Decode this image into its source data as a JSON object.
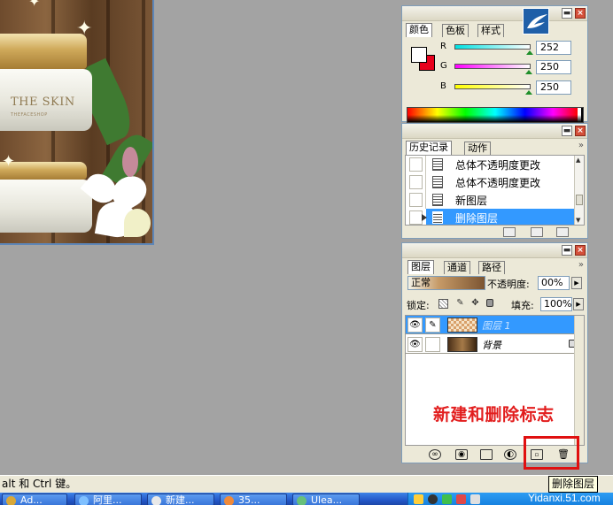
{
  "color_panel": {
    "tabs": [
      "颜色",
      "色板",
      "样式"
    ],
    "channels": [
      {
        "label": "R",
        "value": "252",
        "gradient": [
          "#00e1e1",
          "#ffffff"
        ],
        "fraction": 0.99
      },
      {
        "label": "G",
        "value": "250",
        "gradient": [
          "#ff00ff",
          "#ffffff"
        ],
        "fraction": 0.98
      },
      {
        "label": "B",
        "value": "250",
        "gradient": [
          "#ffff00",
          "#ffffff"
        ],
        "fraction": 0.98
      }
    ],
    "foreground_color": "#ffffff",
    "background_color": "#e8001c"
  },
  "history_panel": {
    "tabs": [
      "历史记录",
      "动作"
    ],
    "items": [
      {
        "label": "总体不透明度更改",
        "active": false
      },
      {
        "label": "总体不透明度更改",
        "active": false
      },
      {
        "label": "新图层",
        "active": false
      },
      {
        "label": "删除图层",
        "active": true
      }
    ]
  },
  "layers_panel": {
    "tabs": [
      "图层",
      "通道",
      "路径"
    ],
    "blend_mode": "正常",
    "opacity_label": "不透明度:",
    "opacity_value": "00%",
    "lock_label": "锁定:",
    "fill_label": "填充:",
    "fill_value": "100%",
    "layers": [
      {
        "name": "图层 1",
        "active": true,
        "locked": false
      },
      {
        "name": "背景",
        "active": false,
        "locked": true
      }
    ]
  },
  "annotation": "新建和删除标志",
  "tooltip": "删除图层",
  "status_bar": "alt 和 Ctrl 键。",
  "taskbar": {
    "tasks": [
      "Ad...",
      "阿里...",
      "新建...",
      "35...",
      "Ulea..."
    ]
  },
  "watermark": "Yidanxi.51.com",
  "colors": {
    "accent": "#3399ff",
    "annotation": "#e21d1d"
  }
}
